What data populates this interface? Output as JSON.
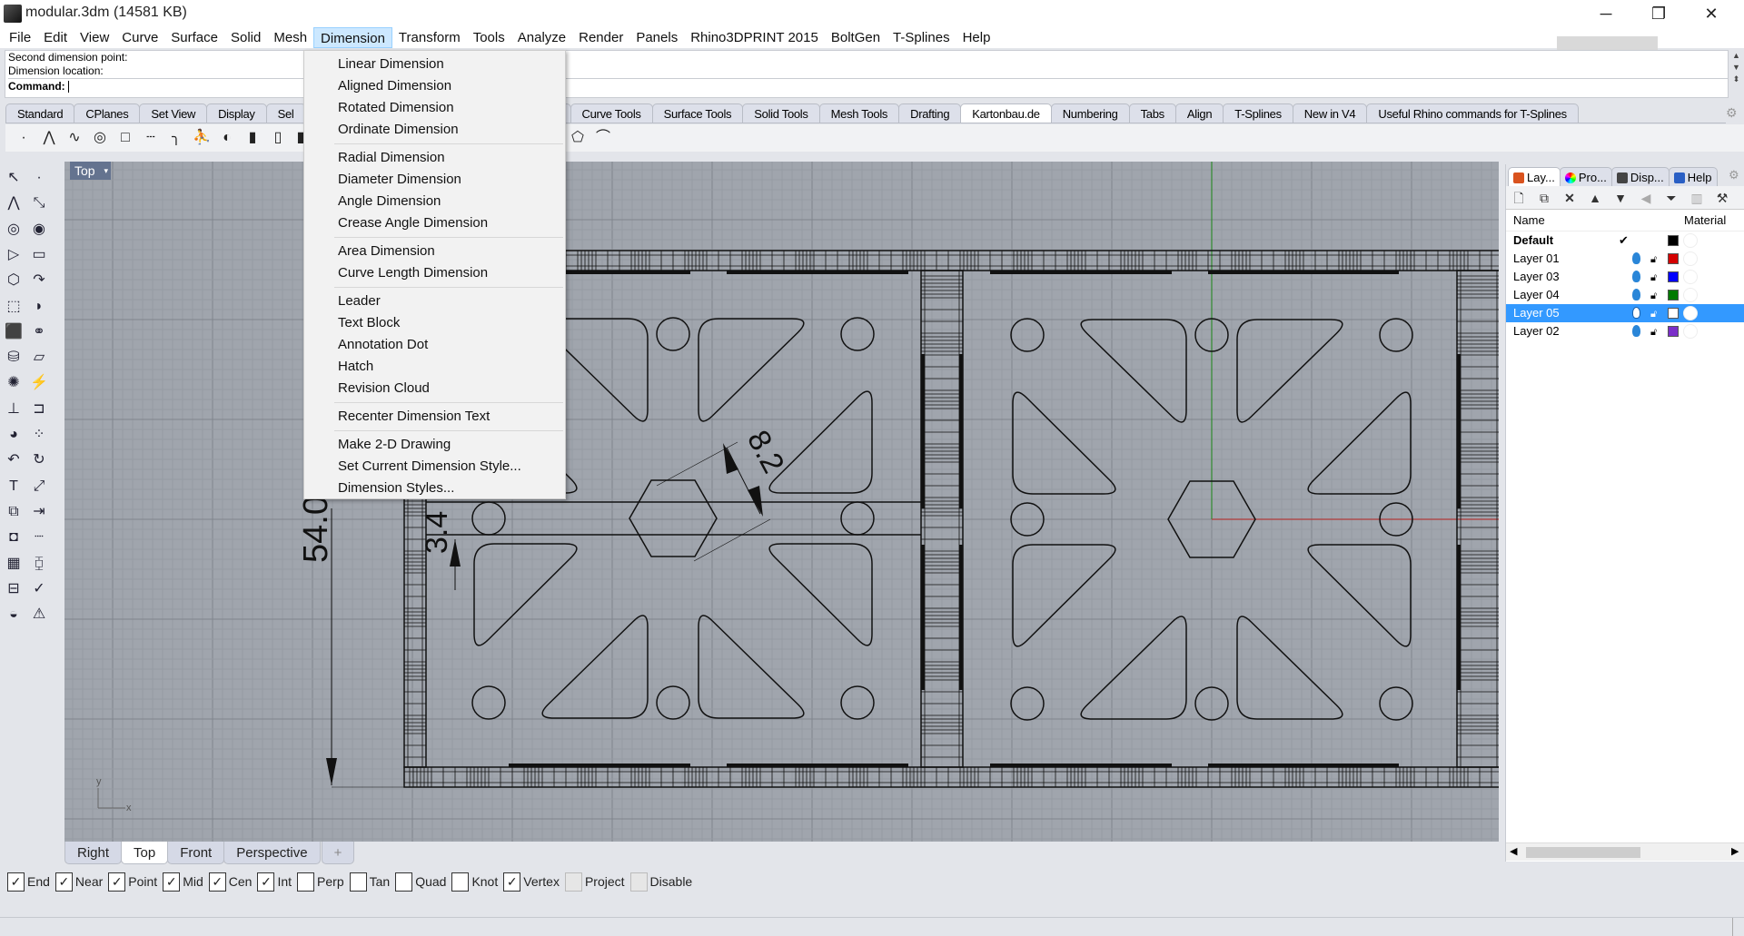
{
  "window": {
    "title": "modular.3dm (14581 KB)",
    "minimize": "─",
    "maximize": "❐",
    "close": "✕"
  },
  "menubar": [
    "File",
    "Edit",
    "View",
    "Curve",
    "Surface",
    "Solid",
    "Mesh",
    "Dimension",
    "Transform",
    "Tools",
    "Analyze",
    "Render",
    "Panels",
    "Rhino3DPRINT 2015",
    "BoltGen",
    "T-Splines",
    "Help"
  ],
  "active_menu": "Dimension",
  "command": {
    "history": [
      "Second dimension point:",
      "Dimension location:"
    ],
    "prompt": "Command:",
    "value": ""
  },
  "toolbar_tabs": [
    "Standard",
    "CPlanes",
    "Set View",
    "Display",
    "Sel",
    "",
    "Curve Tools",
    "Surface Tools",
    "Solid Tools",
    "Mesh Tools",
    "Drafting",
    "Kartonbau.de",
    "Numbering",
    "Tabs",
    "Align",
    "T-Splines",
    "New in V4",
    "Useful Rhino commands for T-Splines"
  ],
  "active_toolbar_tab": "Kartonbau.de",
  "dimension_menu": [
    [
      "Linear Dimension",
      "Aligned Dimension",
      "Rotated Dimension",
      "Ordinate Dimension"
    ],
    [
      "Radial Dimension",
      "Diameter Dimension",
      "Angle Dimension",
      "Crease Angle Dimension"
    ],
    [
      "Area Dimension",
      "Curve Length Dimension"
    ],
    [
      "Leader",
      "Text Block",
      "Annotation Dot",
      "Hatch",
      "Revision Cloud"
    ],
    [
      "Recenter Dimension Text"
    ],
    [
      "Make 2-D Drawing",
      "Set Current Dimension Style...",
      "Dimension Styles..."
    ]
  ],
  "viewport": {
    "title": "Top",
    "dropdown": "▾",
    "axis_x": "x",
    "axis_y": "y",
    "dimensions": {
      "overall": "54.0",
      "slot": "3.4",
      "hex": "8.2"
    },
    "colors": {
      "background": "#a0a5ad",
      "x_axis": "#b03a3a",
      "y_axis": "#2f8a2f"
    }
  },
  "viewport_tabs": [
    "Right",
    "Top",
    "Front",
    "Perspective",
    "+"
  ],
  "active_viewport_tab": "Top",
  "osnaps": [
    {
      "label": "End",
      "checked": true
    },
    {
      "label": "Near",
      "checked": true
    },
    {
      "label": "Point",
      "checked": true
    },
    {
      "label": "Mid",
      "checked": true
    },
    {
      "label": "Cen",
      "checked": true
    },
    {
      "label": "Int",
      "checked": true
    },
    {
      "label": "Perp",
      "checked": false
    },
    {
      "label": "Tan",
      "checked": false
    },
    {
      "label": "Quad",
      "checked": false
    },
    {
      "label": "Knot",
      "checked": false
    },
    {
      "label": "Vertex",
      "checked": true
    },
    {
      "label": "Project",
      "checked": false,
      "disabled": true
    },
    {
      "label": "Disable",
      "checked": false,
      "disabled": true
    }
  ],
  "panel": {
    "tabs": [
      "Lay...",
      "Pro...",
      "Disp...",
      "Help"
    ],
    "columns": {
      "name": "Name",
      "material": "Material"
    },
    "layers": [
      {
        "name": "Default",
        "current": true,
        "color": "#000000"
      },
      {
        "name": "Layer 01",
        "color": "#d40000"
      },
      {
        "name": "Layer 03",
        "color": "#0000ff"
      },
      {
        "name": "Layer 04",
        "color": "#007a00"
      },
      {
        "name": "Layer 05",
        "color": "#ffffff",
        "selected": true
      },
      {
        "name": "Layer 02",
        "color": "#7b2fc9"
      }
    ]
  }
}
